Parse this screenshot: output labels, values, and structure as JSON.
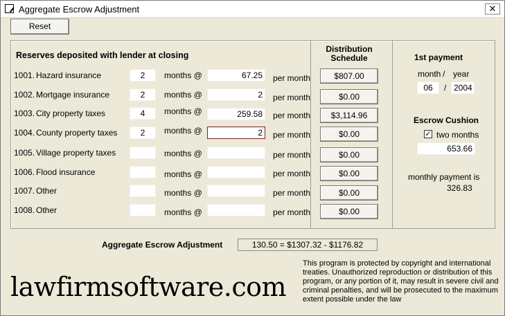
{
  "window": {
    "title": "Aggregate Escrow Adjustment",
    "close_glyph": "✕"
  },
  "toolbar": {
    "reset_label": "Reset"
  },
  "reserves": {
    "heading": "Reserves deposited with lender at closing",
    "months_label": "months @",
    "per_label": "per month",
    "rows": [
      {
        "num": "1001.",
        "name": "Hazard insurance",
        "months": "2",
        "rate": "67.25",
        "amount": "$807.00"
      },
      {
        "num": "1002.",
        "name": "Mortgage insurance",
        "months": "2",
        "rate": "2",
        "amount": "$0.00"
      },
      {
        "num": "1003.",
        "name": "City property taxes",
        "months": "4",
        "rate": "259.58",
        "amount": "$3,114.96"
      },
      {
        "num": "1004.",
        "name": "County property taxes",
        "months": "2",
        "rate": "2",
        "amount": "$0.00"
      },
      {
        "num": "1005.",
        "name": "Village property taxes",
        "months": "",
        "rate": "",
        "amount": "$0.00"
      },
      {
        "num": "1006.",
        "name": "Flood insurance",
        "months": "",
        "rate": "",
        "amount": "$0.00"
      },
      {
        "num": "1007.",
        "name": "Other",
        "months": "",
        "rate": "",
        "amount": "$0.00"
      },
      {
        "num": "1008.",
        "name": "Other",
        "months": "",
        "rate": "",
        "amount": "$0.00"
      }
    ]
  },
  "distribution": {
    "heading_line1": "Distribution",
    "heading_line2": "Schedule"
  },
  "first_payment": {
    "heading": "1st payment",
    "month_label": "month",
    "slash": "/",
    "year_label": "year",
    "month_value": "06",
    "year_value": "2004"
  },
  "escrow_cushion": {
    "heading": "Escrow Cushion",
    "check_glyph": "✓",
    "checkbox_label": "two months",
    "value": "653.66",
    "monthly_label": "monthly payment is",
    "monthly_value": "326.83"
  },
  "aggregate": {
    "label": "Aggregate Escrow Adjustment",
    "value": "130.50 = $1307.32 - $1176.82"
  },
  "footer": {
    "logo": "lawfirmsoftware.com",
    "notice": "This program is protected by copyright and international treaties.  Unauthorized reproduction or distribution of this program, or any portion of it, may result in severe civil and criminal penalties, and will be prosecuted to the maximum extent possible under the law"
  }
}
